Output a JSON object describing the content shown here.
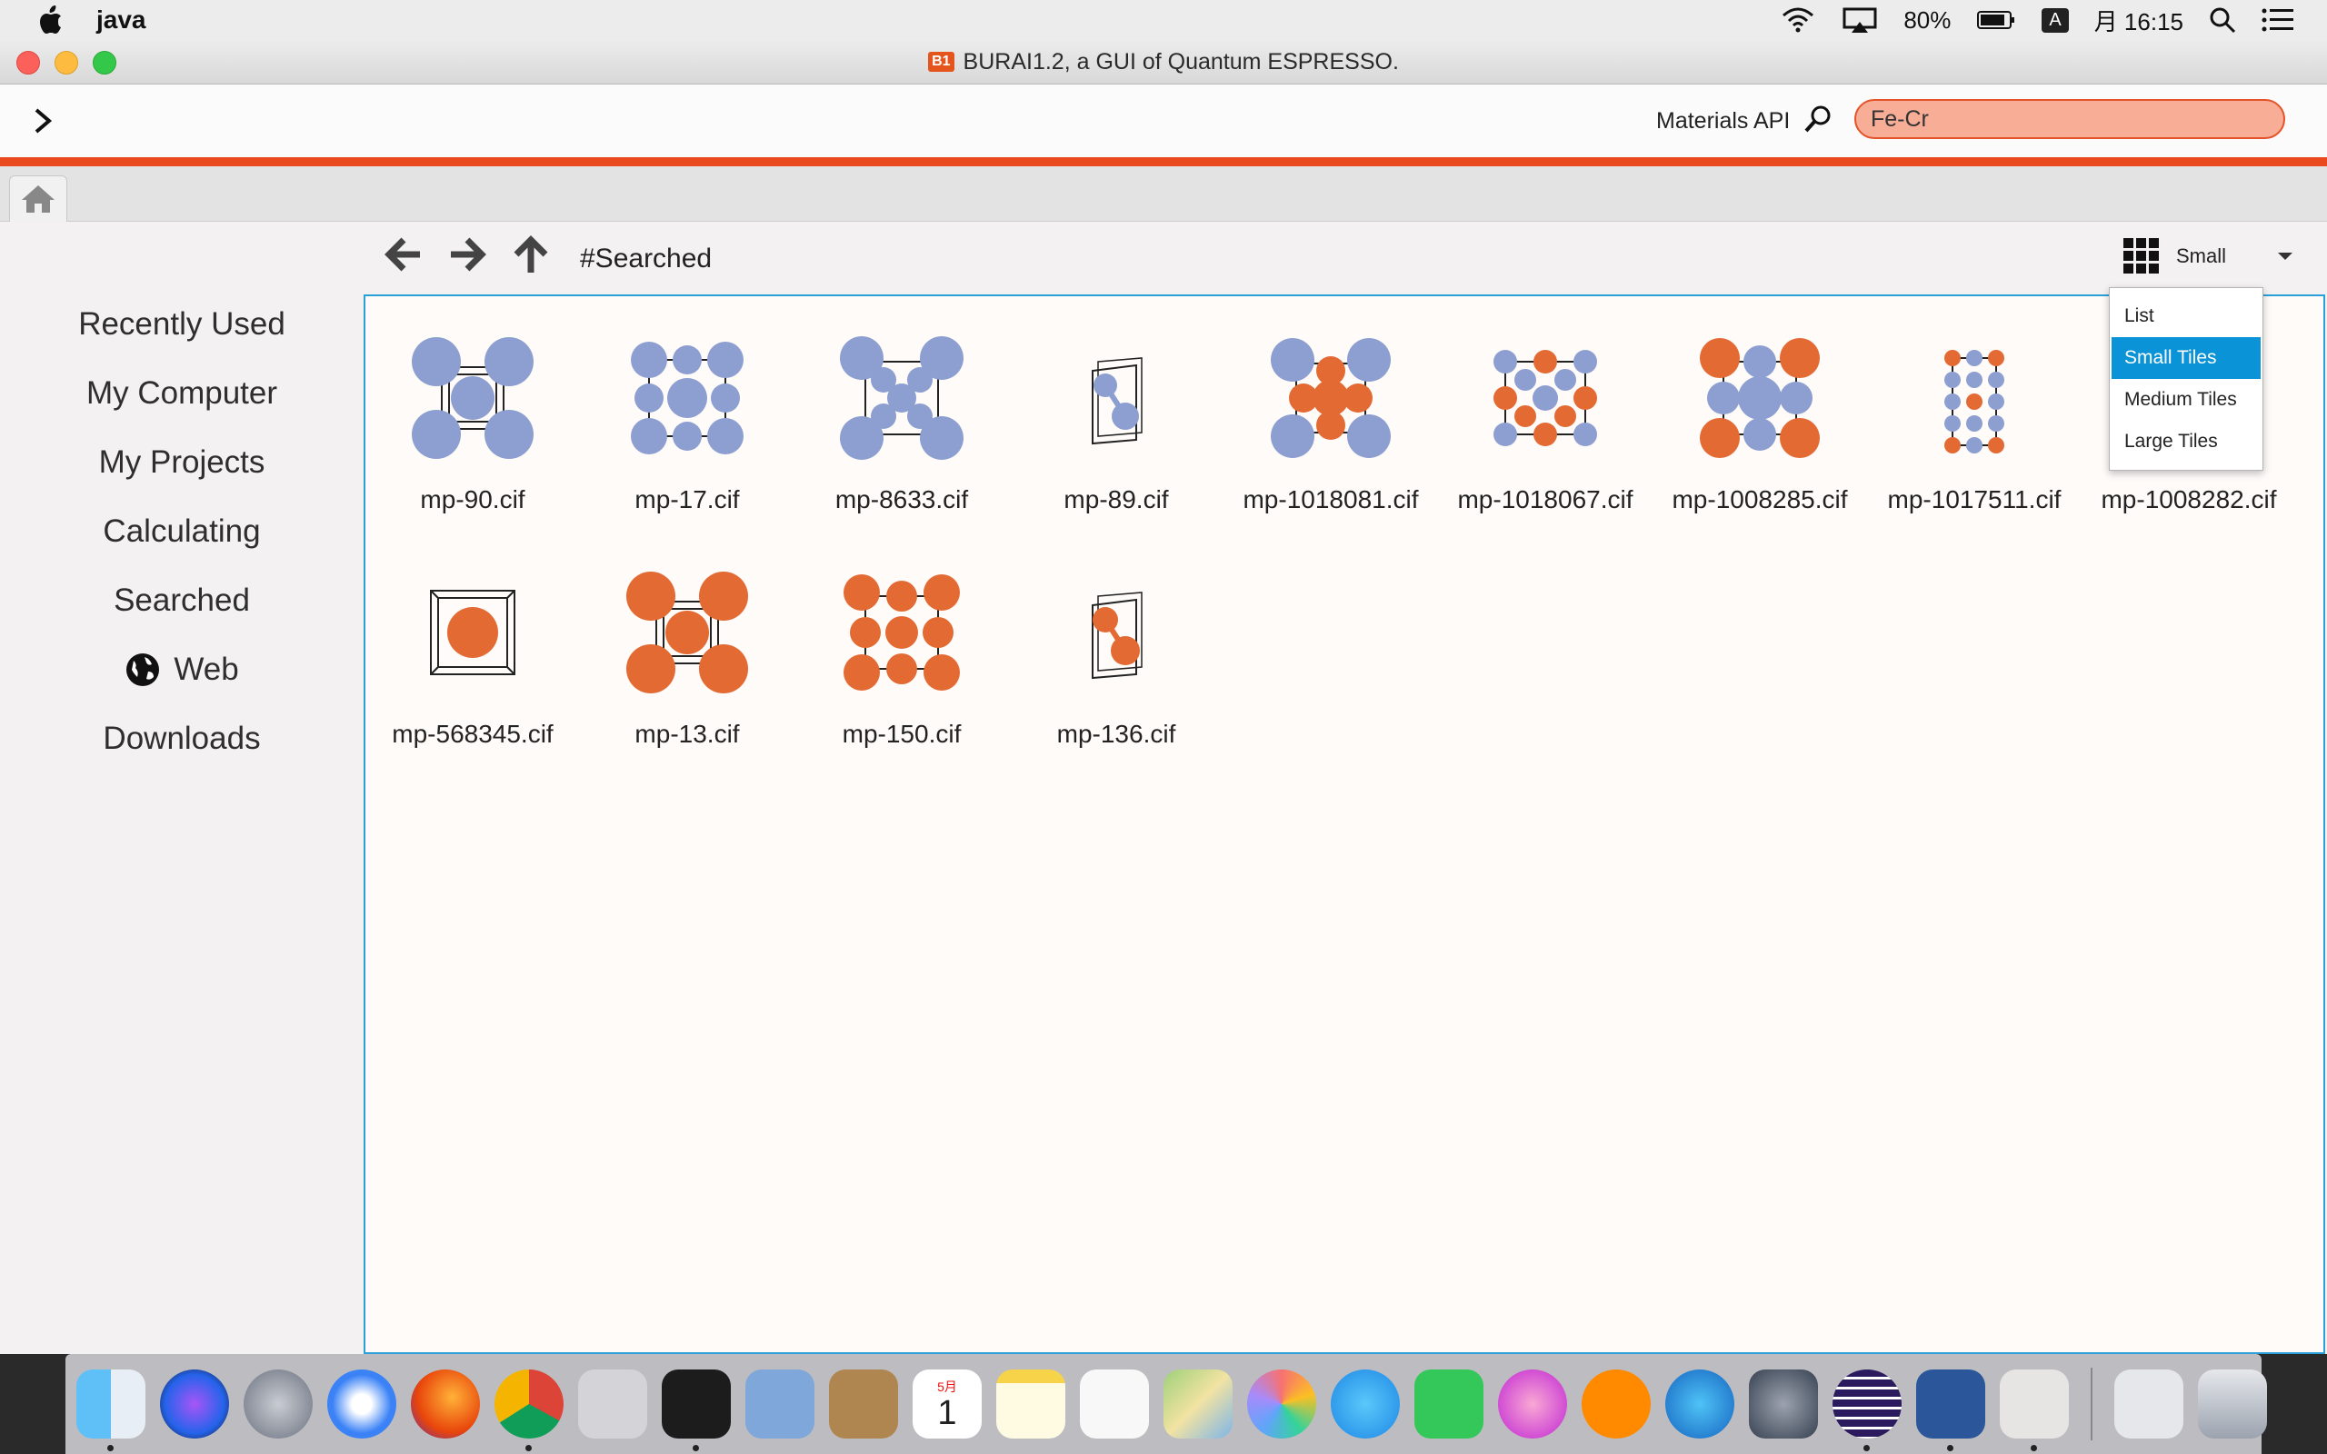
{
  "menubar": {
    "app_name": "java",
    "battery": "80%",
    "input_mode": "A",
    "clock": "月 16:15"
  },
  "window": {
    "title": "BURAI1.2, a GUI of Quantum ESPRESSO.",
    "badge": "B1"
  },
  "toolbar": {
    "api_label": "Materials API",
    "search_value": "Fe-Cr"
  },
  "sidebar": {
    "items": [
      {
        "label": "Recently Used"
      },
      {
        "label": "My Computer"
      },
      {
        "label": "My Projects"
      },
      {
        "label": "Calculating"
      },
      {
        "label": "Searched"
      },
      {
        "label": "Web"
      },
      {
        "label": "Downloads"
      }
    ]
  },
  "browser": {
    "path": "#Searched",
    "view_label": "Small",
    "view_options": [
      "List",
      "Small Tiles",
      "Medium Tiles",
      "Large Tiles"
    ],
    "selected_view": "Small Tiles"
  },
  "colors": {
    "fe_atom": "#8d9ed0",
    "cr_atom": "#e36a33",
    "accent": "#e9491c",
    "selection": "#0a93d6"
  },
  "files": [
    {
      "name": "mp-90.cif",
      "icon": "bcc-cell-blue-icon"
    },
    {
      "name": "mp-17.cif",
      "icon": "cell-blue-icon"
    },
    {
      "name": "mp-8633.cif",
      "icon": "fcc-cell-blue-icon"
    },
    {
      "name": "mp-89.cif",
      "icon": "two-atom-cell-blue-icon"
    },
    {
      "name": "mp-1018081.cif",
      "icon": "mixed-cell-icon"
    },
    {
      "name": "mp-1018067.cif",
      "icon": "mixed-cell-icon"
    },
    {
      "name": "mp-1008285.cif",
      "icon": "mixed-cell-icon"
    },
    {
      "name": "mp-1017511.cif",
      "icon": "mixed-tall-cell-icon"
    },
    {
      "name": "mp-1008282.cif",
      "icon": "mixed-cell-icon"
    },
    {
      "name": "mp-568345.cif",
      "icon": "single-atom-cell-orange-icon"
    },
    {
      "name": "mp-13.cif",
      "icon": "bcc-cell-orange-icon"
    },
    {
      "name": "mp-150.cif",
      "icon": "cell-orange-icon"
    },
    {
      "name": "mp-136.cif",
      "icon": "two-atom-cell-orange-icon"
    }
  ],
  "dock": {
    "apps": [
      "Finder",
      "Siri",
      "Launchpad",
      "Safari",
      "Firefox",
      "Chrome",
      "Preview",
      "Terminal",
      "Mail",
      "Contacts",
      "Calendar",
      "Notes",
      "Reminders",
      "Maps",
      "Photos",
      "Messages",
      "FaceTime",
      "iTunes",
      "iBooks",
      "App Store",
      "System Preferences",
      "Eclipse",
      "Word",
      "Java",
      "Downloads",
      "Trash"
    ],
    "calendar_month": "5月",
    "calendar_day": "1"
  }
}
